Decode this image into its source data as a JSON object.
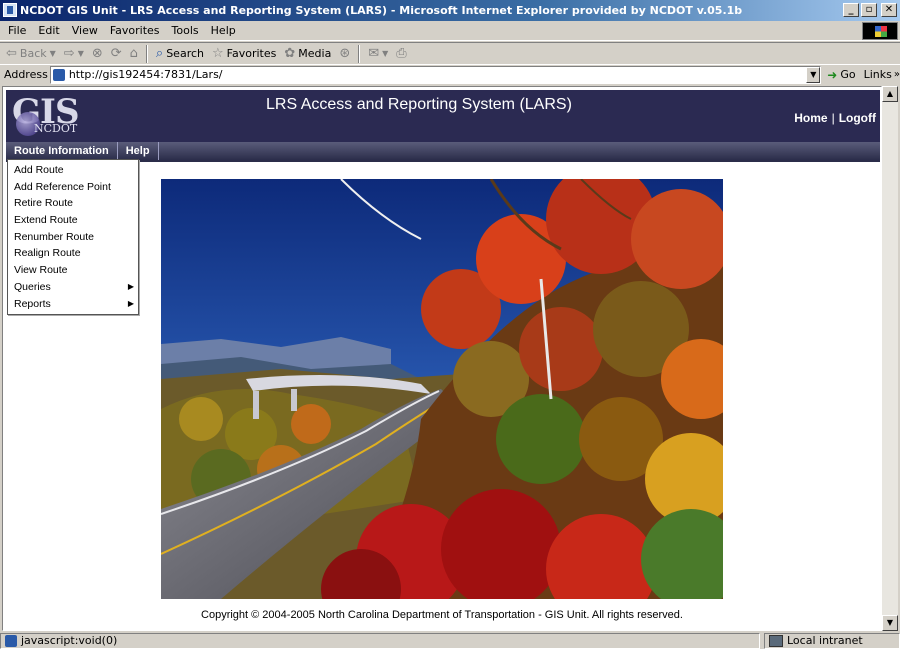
{
  "window": {
    "title": "NCDOT GIS Unit - LRS Access and Reporting System (LARS) - Microsoft Internet Explorer provided by NCDOT v.05.1b",
    "minimize": "_",
    "maximize": "▫",
    "close": "✕"
  },
  "browser_menu": [
    "File",
    "Edit",
    "View",
    "Favorites",
    "Tools",
    "Help"
  ],
  "toolbar": {
    "back": "Back",
    "search": "Search",
    "favorites": "Favorites",
    "media": "Media"
  },
  "address": {
    "label": "Address",
    "url": "http://gis192454:7831/Lars/",
    "go": "Go",
    "links": "Links"
  },
  "app": {
    "logo_text": "GIS",
    "logo_sub": "NCDOT",
    "title": "LRS Access and Reporting System (LARS)",
    "nav": {
      "home": "Home",
      "separator": "|",
      "logoff": "Logoff"
    },
    "menu": [
      "Route Information",
      "Help"
    ],
    "dropdown": [
      {
        "label": "Add Route",
        "submenu": false
      },
      {
        "label": "Add Reference Point",
        "submenu": false
      },
      {
        "label": "Retire Route",
        "submenu": false
      },
      {
        "label": "Extend Route",
        "submenu": false
      },
      {
        "label": "Renumber Route",
        "submenu": false
      },
      {
        "label": "Realign Route",
        "submenu": false
      },
      {
        "label": "View Route",
        "submenu": false
      },
      {
        "label": "Queries",
        "submenu": true
      },
      {
        "label": "Reports",
        "submenu": true
      }
    ],
    "copyright": "Copyright © 2004-2005 North Carolina Department of Transportation - GIS Unit. All rights reserved."
  },
  "status": {
    "text": "javascript:void(0)",
    "zone": "Local intranet"
  },
  "colors": {
    "header_bg": "#2b2a52",
    "titlebar": "#0a246a"
  }
}
